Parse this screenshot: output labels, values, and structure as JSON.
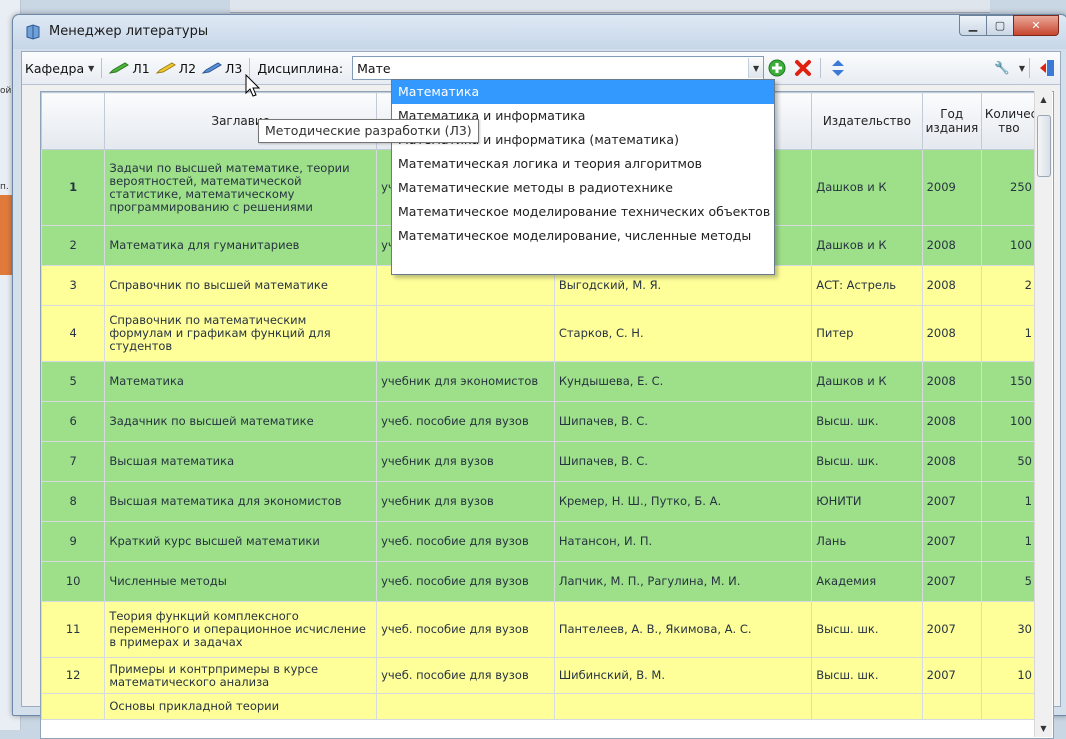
{
  "window": {
    "title": "Менеджер литературы"
  },
  "background": {
    "left_fragments": [
      "ой",
      "п."
    ]
  },
  "toolbar": {
    "kafedra_label": "Кафедра",
    "l1_label": "Л1",
    "l2_label": "Л2",
    "l3_label": "Л3",
    "discipline_label": "Дисциплина:",
    "discipline_value": "Мате"
  },
  "tooltip": {
    "text": "Методические разработки (Л3)"
  },
  "dropdown": {
    "options": [
      "Математика",
      "Математика и информатика",
      "Математика и информатика (математика)",
      "Математическая логика и теория алгоритмов",
      "Математические методы в радиотехнике",
      "Математическое моделирование технических объектов",
      "Математическое моделирование, численные методы"
    ],
    "selected_index": 0
  },
  "table": {
    "headers": [
      "",
      "Заглавие",
      "",
      "",
      "Издательство",
      "Год издания",
      "Количество"
    ],
    "header_lines": {
      "year": [
        "Год",
        "издания"
      ],
      "count": [
        "Количес",
        "тво"
      ],
      "title": "Заглавие"
    },
    "rows": [
      {
        "n": "1",
        "title": "Задачи по высшей математике, теории вероятностей, математической статистике, математическому программированию с решениями",
        "type": "учеб",
        "author": "",
        "publisher": "Дашков и К",
        "year": "2009",
        "count": "250",
        "color": "green"
      },
      {
        "n": "2",
        "title": "Математика для гуманитариев",
        "type": "уче",
        "author": "",
        "publisher": "Дашков и К",
        "year": "2008",
        "count": "100",
        "color": "green"
      },
      {
        "n": "3",
        "title": "Справочник по высшей математике",
        "type": "",
        "author": "Выгодский, М. Я.",
        "publisher": "АСТ: Астрель",
        "year": "2008",
        "count": "2",
        "color": "yellow"
      },
      {
        "n": "4",
        "title": "Справочник по математическим формулам и графикам функций для студентов",
        "type": "",
        "author": "Старков, С. Н.",
        "publisher": "Питер",
        "year": "2008",
        "count": "1",
        "color": "yellow"
      },
      {
        "n": "5",
        "title": "Математика",
        "type": "учебник для экономистов",
        "author": "Кундышева, Е. С.",
        "publisher": "Дашков и К",
        "year": "2008",
        "count": "150",
        "color": "green"
      },
      {
        "n": "6",
        "title": "Задачник по высшей математике",
        "type": "учеб. пособие для вузов",
        "author": "Шипачев, В. С.",
        "publisher": "Высш. шк.",
        "year": "2008",
        "count": "100",
        "color": "green"
      },
      {
        "n": "7",
        "title": "Высшая математика",
        "type": "учебник для вузов",
        "author": "Шипачев, В. С.",
        "publisher": "Высш. шк.",
        "year": "2008",
        "count": "50",
        "color": "green"
      },
      {
        "n": "8",
        "title": "Высшая математика для экономистов",
        "type": "учебник для вузов",
        "author": "Кремер, Н. Ш., Путко, Б. А.",
        "publisher": "ЮНИТИ",
        "year": "2007",
        "count": "1",
        "color": "green"
      },
      {
        "n": "9",
        "title": "Краткий курс высшей математики",
        "type": "учеб. пособие для вузов",
        "author": "Натансон, И. П.",
        "publisher": "Лань",
        "year": "2007",
        "count": "1",
        "color": "green"
      },
      {
        "n": "10",
        "title": "Численные методы",
        "type": "учеб. пособие для вузов",
        "author": "Лапчик, М. П., Рагулина, М. И.",
        "publisher": "Академия",
        "year": "2007",
        "count": "5",
        "color": "green"
      },
      {
        "n": "11",
        "title": "Теория функций комплексного переменного и операционное исчисление в примерах и задачах",
        "type": "учеб. пособие для вузов",
        "author": "Пантелеев, А. В., Якимова, А. С.",
        "publisher": "Высш. шк.",
        "year": "2007",
        "count": "30",
        "color": "yellow"
      },
      {
        "n": "12",
        "title": "Примеры и контрпримеры в курсе математического анализа",
        "type": "учеб. пособие для вузов",
        "author": "Шибинский, В. М.",
        "publisher": "Высш. шк.",
        "year": "2007",
        "count": "10",
        "color": "yellow"
      },
      {
        "n": "",
        "title": "Основы прикладной теории",
        "type": "",
        "author": "",
        "publisher": "",
        "year": "",
        "count": "",
        "color": "yellow"
      }
    ]
  },
  "colors": {
    "green_row": "#9ee08a",
    "yellow_row": "#ffff9a",
    "selection": "#3399ff"
  }
}
